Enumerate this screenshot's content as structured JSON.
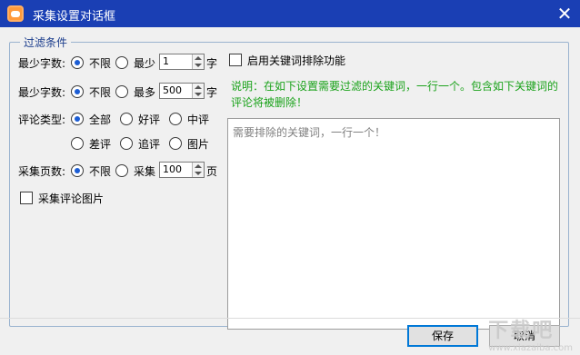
{
  "window": {
    "title": "采集设置对话框",
    "close_glyph": "✕"
  },
  "filter_group": {
    "title": "过滤条件",
    "min_chars": {
      "label": "最少字数:",
      "opt_unlimited": "不限",
      "opt_min": "最少",
      "value": "1",
      "unit": "字"
    },
    "max_chars": {
      "label": "最少字数:",
      "opt_unlimited": "不限",
      "opt_max": "最多",
      "value": "500",
      "unit": "字"
    },
    "comment_type": {
      "label": "评论类型:",
      "options": [
        "全部",
        "好评",
        "中评",
        "差评",
        "追评",
        "图片"
      ]
    },
    "pages": {
      "label": "采集页数:",
      "opt_unlimited": "不限",
      "opt_collect": "采集",
      "value": "100",
      "unit": "页"
    },
    "collect_images_label": "采集评论图片",
    "keyword_filter_label": "启用关键词排除功能",
    "note": "说明：在如下设置需要过滤的关键词，一行一个。包含如下关键词的评论将被删除！",
    "keywords_placeholder": "需要排除的关键词，一行一个！"
  },
  "buttons": {
    "save": "保存",
    "cancel": "取消"
  },
  "watermark": {
    "main": "下载吧",
    "sub": "www.xiazaiba.com"
  },
  "colors": {
    "titlebar": "#1a3fb4",
    "accent": "#1c5dd4",
    "note": "#1aa21a"
  }
}
